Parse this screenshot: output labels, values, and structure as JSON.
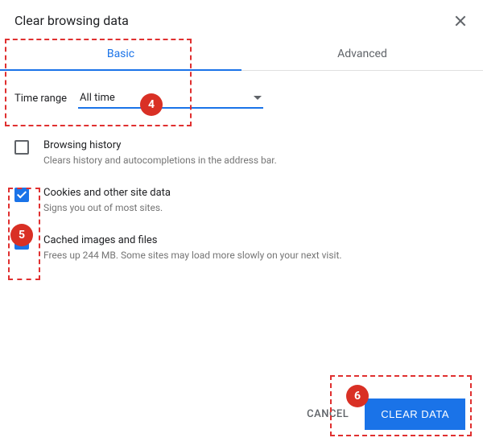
{
  "dialog": {
    "title": "Clear browsing data"
  },
  "tabs": {
    "basic": "Basic",
    "advanced": "Advanced"
  },
  "time": {
    "label": "Time range",
    "selected": "All time"
  },
  "options": [
    {
      "title": "Browsing history",
      "desc": "Clears history and autocompletions in the address bar.",
      "checked": false
    },
    {
      "title": "Cookies and other site data",
      "desc": "Signs you out of most sites.",
      "checked": true
    },
    {
      "title": "Cached images and files",
      "desc": "Frees up 244 MB. Some sites may load more slowly on your next visit.",
      "checked": true
    }
  ],
  "actions": {
    "cancel": "CANCEL",
    "clear": "CLEAR DATA"
  },
  "annotations": {
    "badge4": "4",
    "badge5": "5",
    "badge6": "6"
  }
}
